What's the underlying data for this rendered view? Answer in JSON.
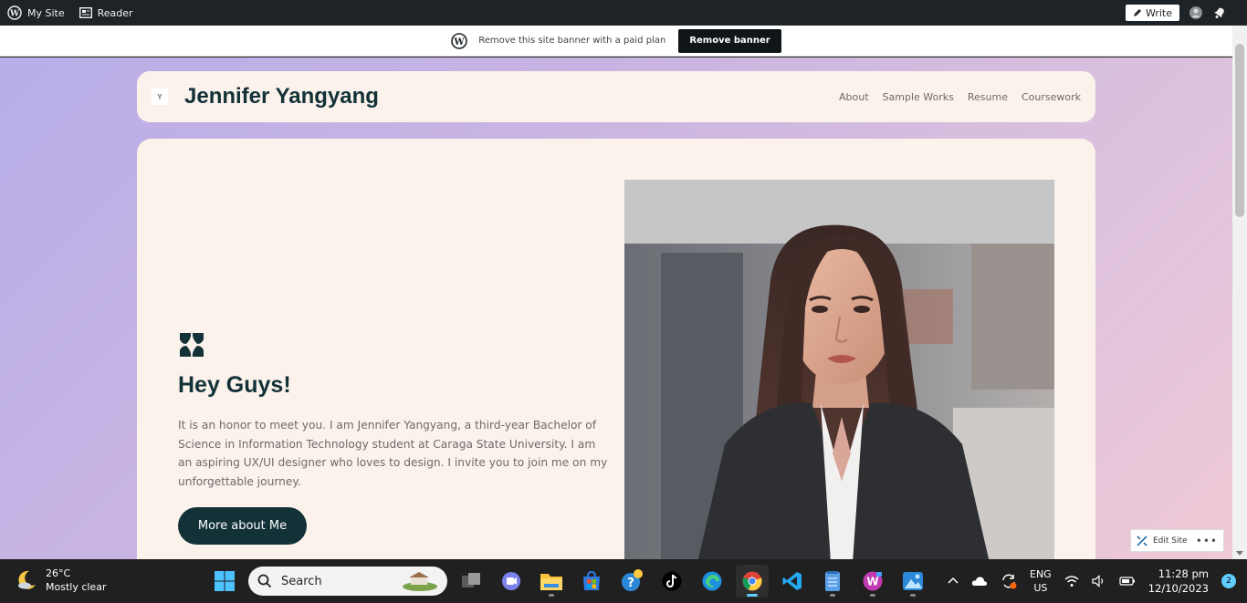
{
  "adminbar": {
    "my_site": "My Site",
    "reader": "Reader",
    "write": "Write"
  },
  "banner": {
    "text": "Remove this site banner with a paid plan",
    "button": "Remove banner"
  },
  "site": {
    "logo_letter": "Y",
    "title": "Jennifer Yangyang",
    "nav": [
      "About",
      "Sample Works",
      "Resume",
      "Coursework"
    ]
  },
  "hero": {
    "title": "Hey Guys!",
    "text": "It is an honor to meet you. I am Jennifer Yangyang, a third-year Bachelor of Science in Information Technology student at Caraga State University. I am an aspiring UX/UI designer who loves to design. I invite you to join me on my unforgettable journey.",
    "button": "More about Me"
  },
  "edit_site": {
    "label": "Edit Site",
    "more": "•••"
  },
  "taskbar": {
    "weather_temp": "26°C",
    "weather_desc": "Mostly clear",
    "search_placeholder": "Search",
    "lang_top": "ENG",
    "lang_bottom": "US",
    "time": "11:28 pm",
    "date": "12/10/2023",
    "notifications": "2"
  },
  "colors": {
    "brand_dark": "#123238",
    "card_bg": "#fcf2ec",
    "taskbar_accent": "#60cdff"
  }
}
